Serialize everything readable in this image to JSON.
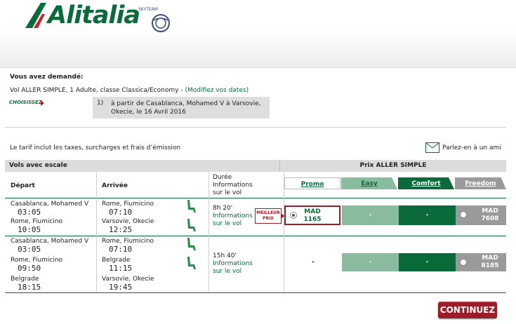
{
  "brand": {
    "name": "Alitalia",
    "alliance": "SKYTEAM"
  },
  "request": {
    "heading": "Vous avez demandé:",
    "summary": "Vol ALLER SIMPLE, 1 Adulte, classe Classica/Economy  -",
    "modify_link": "(Modifiez vos dates)",
    "choose_label": "CHOISISSEZ",
    "segment_number": "1)",
    "segment_text": "à partir de  Casablanca, Mohamed V à Varsovie, Okecie, le 16 Avril 2016"
  },
  "tax_note": "Le tarif inclut les taxes, surcharges et frais d’émission",
  "share_link": "Parlez-en à un ami",
  "table": {
    "section_title": "Vols avec escale",
    "price_title": "Prix ALLER SIMPLE",
    "col_depart": "Départ",
    "col_arrival": "Arrivée",
    "col_duration": [
      "Durée",
      "Informations",
      "sur le vol"
    ],
    "tabs": {
      "promo": "Promo",
      "easy": "Easy",
      "comfort": "Comfort",
      "freedom": "Freedom"
    },
    "best_price_label": "MEILLEUR PRIX",
    "options": [
      {
        "legs": [
          {
            "dep_city": "Casablanca, Mohamed V",
            "dep_time": "03:05",
            "arr_city": "Rome, Fiumicino",
            "arr_time": "07:10"
          },
          {
            "dep_city": "Rome, Fiumicino",
            "dep_time": "10:05",
            "arr_city": "Varsovie, Okecie",
            "arr_time": "12:25"
          }
        ],
        "duration": "8h 20'",
        "info_link": "Informations",
        "info_link2": "sur le vol",
        "fares": {
          "promo": {
            "currency": "MAD",
            "amount": "1165"
          },
          "easy": "-",
          "comfort": "-",
          "freedom": {
            "currency": "MAD",
            "amount": "7608"
          }
        }
      },
      {
        "legs": [
          {
            "dep_city": "Casablanca, Mohamed V",
            "dep_time": "03:05",
            "arr_city": "Rome, Fiumicino",
            "arr_time": "07:10"
          },
          {
            "dep_city": "Rome, Fiumicino",
            "dep_time": "09:50",
            "arr_city": "Belgrade",
            "arr_time": "11:15"
          },
          {
            "dep_city": "Belgrade",
            "dep_time": "18:15",
            "arr_city": "Varsovie, Okecie",
            "arr_time": "19:45"
          }
        ],
        "duration": "15h 40'",
        "info_link": "Informations",
        "info_link2": "sur le vol",
        "fares": {
          "promo": "-",
          "easy": "-",
          "comfort": "-",
          "freedom": {
            "currency": "MAD",
            "amount": "8185"
          }
        }
      }
    ]
  },
  "continue_button": "CONTINUEZ",
  "colors": {
    "brand_green": "#0a6a3a",
    "easy_green": "#89bb9e",
    "freedom_grey": "#9a9a9a",
    "accent_red": "#9b1d2a"
  }
}
